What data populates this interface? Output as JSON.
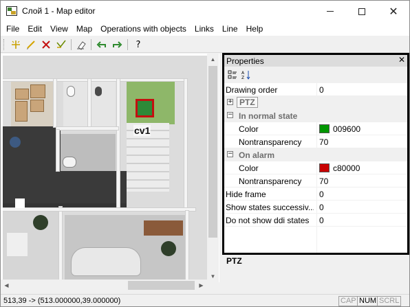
{
  "window": {
    "title": "Слой 1 - Map editor",
    "minimize": "",
    "maximize": "",
    "close": "✕"
  },
  "menu": [
    "File",
    "Edit",
    "View",
    "Map",
    "Operations with objects",
    "Links",
    "Line",
    "Help"
  ],
  "toolbar": {
    "icons": [
      "add-point-icon",
      "pencil-icon",
      "delete-icon",
      "vertex-edit-icon",
      "eraser-icon",
      "undo-icon",
      "redo-icon",
      "help-icon"
    ],
    "help_label": "?"
  },
  "map": {
    "camera_label": "cv1"
  },
  "properties": {
    "title": "Properties",
    "close_label": "✕",
    "rows": {
      "drawing_order": {
        "name": "Drawing order",
        "value": "0"
      },
      "ptz": {
        "name": "PTZ"
      },
      "in_normal_state": {
        "name": "In normal state"
      },
      "normal_color": {
        "name": "Color",
        "value": "009600",
        "swatch": "#009600"
      },
      "normal_nontransparency": {
        "name": "Nontransparency",
        "value": "70"
      },
      "on_alarm": {
        "name": "On alarm"
      },
      "alarm_color": {
        "name": "Color",
        "value": "c80000",
        "swatch": "#c80000"
      },
      "alarm_nontransparency": {
        "name": "Nontransparency",
        "value": "70"
      },
      "hide_frame": {
        "name": "Hide frame",
        "value": "0"
      },
      "show_states": {
        "name": "Show states successiv...",
        "value": "0"
      },
      "no_ddi_states": {
        "name": "Do not show ddi states",
        "value": "0"
      }
    }
  },
  "description": {
    "title": "PTZ"
  },
  "status": {
    "coords": "513,39 -> (513.000000,39.000000)",
    "indicators": [
      {
        "label": "CAP",
        "on": false
      },
      {
        "label": "NUM",
        "on": true
      },
      {
        "label": "SCRL",
        "on": false
      }
    ]
  }
}
